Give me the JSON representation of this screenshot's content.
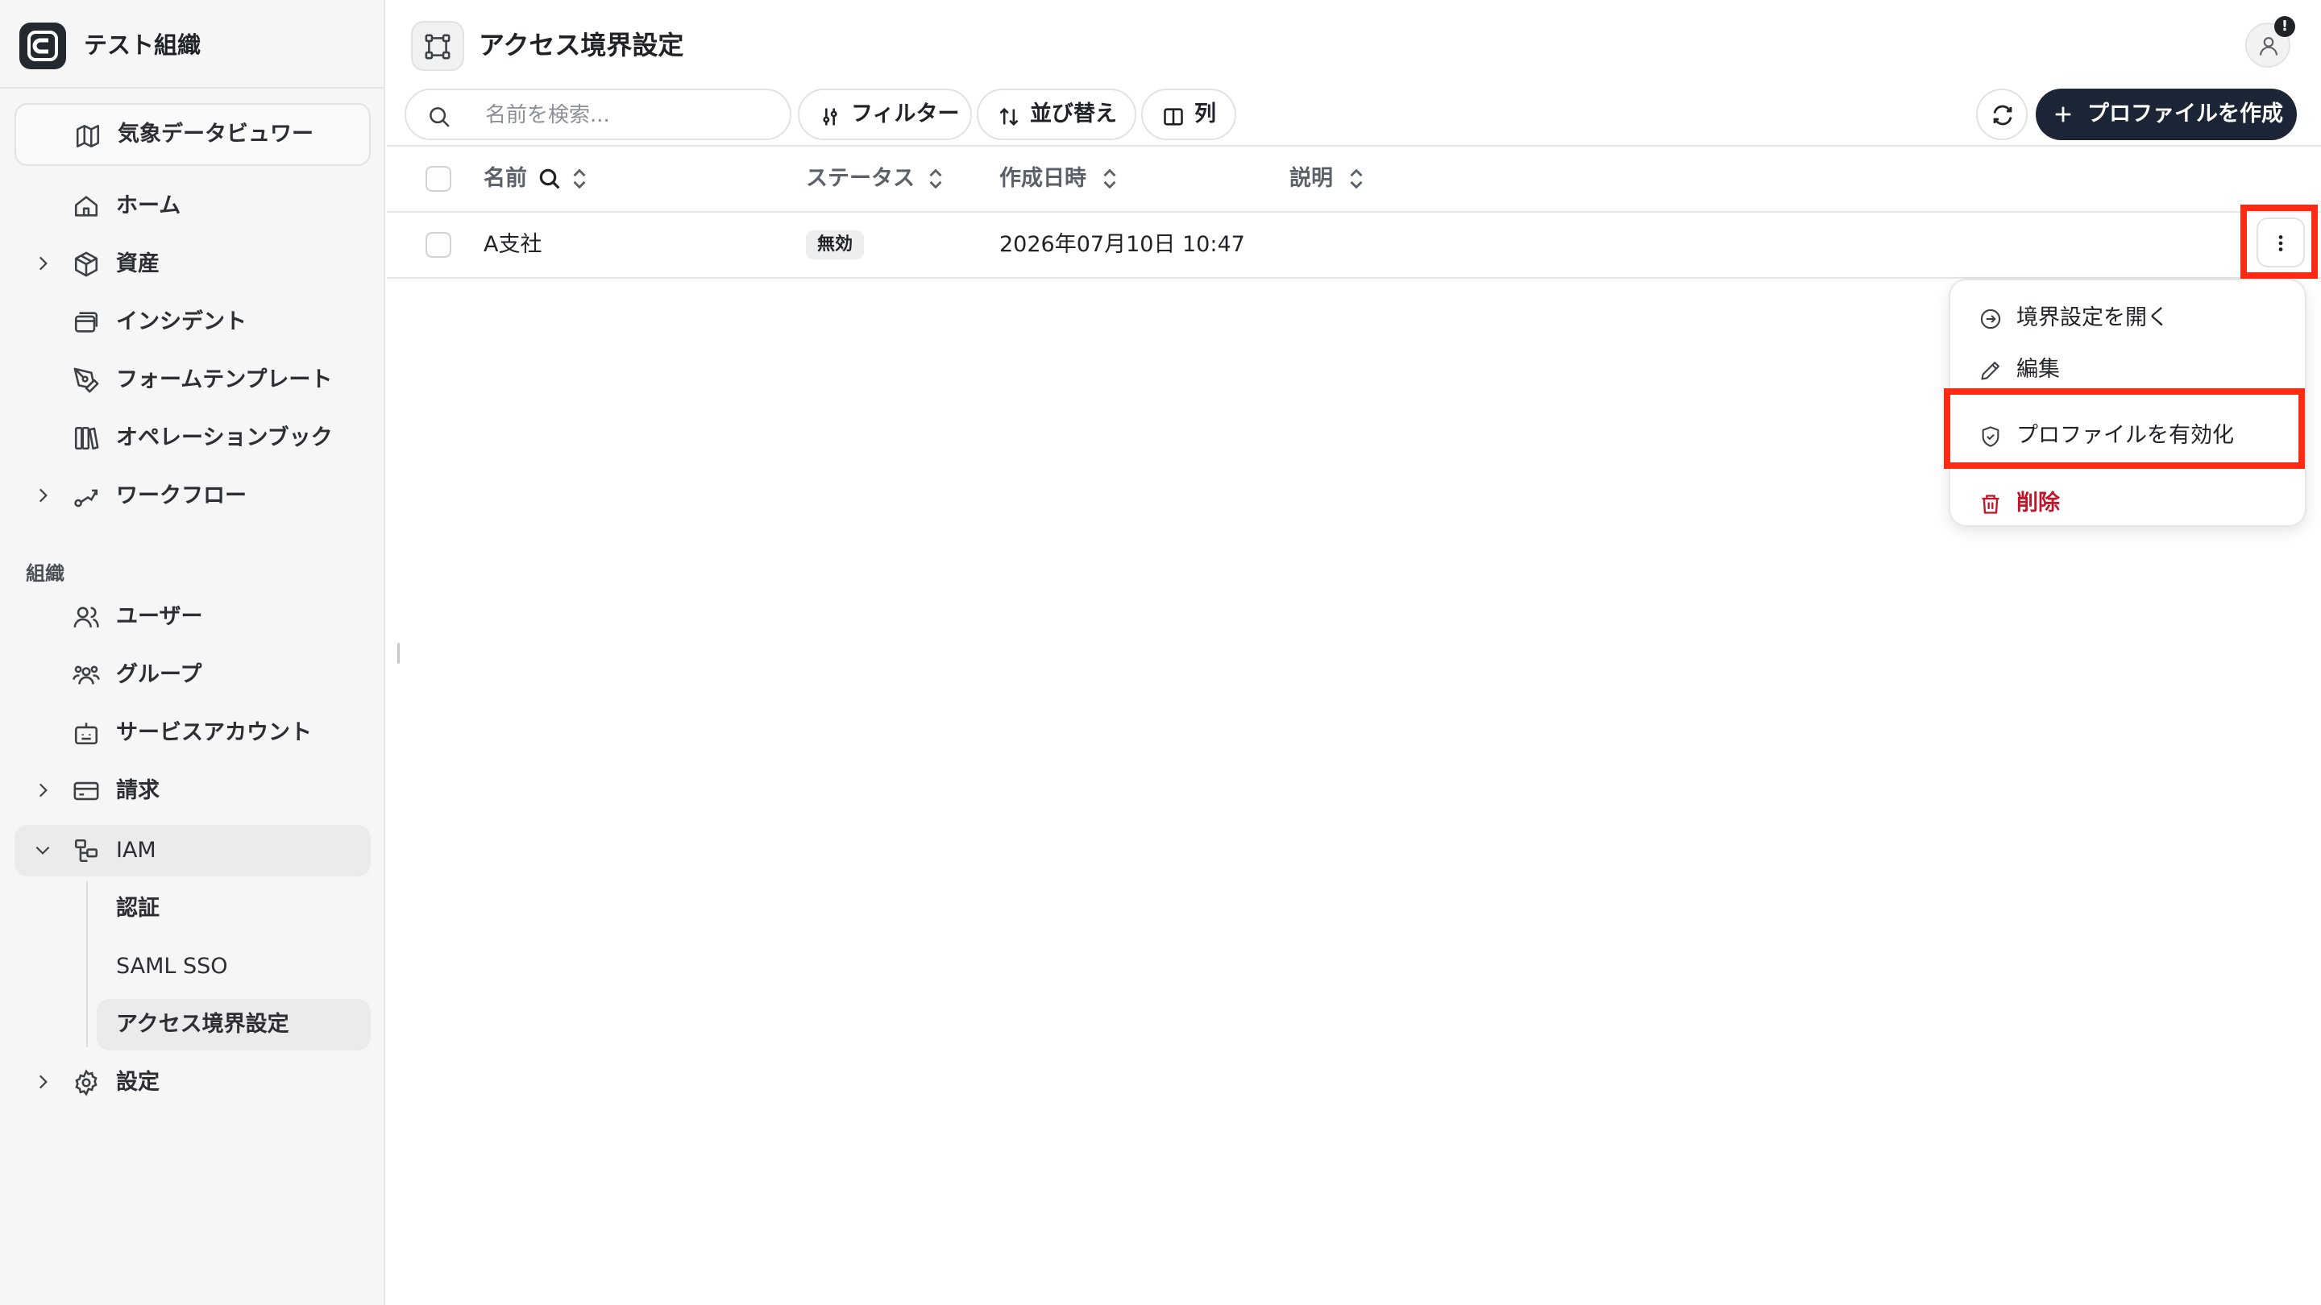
{
  "org": {
    "name": "テスト組織"
  },
  "sidebar": {
    "weather_viewer": "気象データビュワー",
    "items": [
      {
        "label": "ホーム"
      },
      {
        "label": "資産"
      },
      {
        "label": "インシデント"
      },
      {
        "label": "フォームテンプレート"
      },
      {
        "label": "オペレーションブック"
      },
      {
        "label": "ワークフロー"
      }
    ],
    "section_label": "組織",
    "org_items": [
      {
        "label": "ユーザー"
      },
      {
        "label": "グループ"
      },
      {
        "label": "サービスアカウント"
      },
      {
        "label": "請求"
      },
      {
        "label": "IAM"
      }
    ],
    "iam_sub": [
      {
        "label": "認証"
      },
      {
        "label": "SAML SSO"
      },
      {
        "label": "アクセス境界設定"
      }
    ],
    "settings": "設定"
  },
  "header": {
    "title": "アクセス境界設定",
    "notification_badge": "!"
  },
  "toolbar": {
    "search_placeholder": "名前を検索...",
    "filter": "フィルター",
    "sort": "並び替え",
    "columns": "列",
    "create": "プロファイルを作成"
  },
  "table": {
    "headers": {
      "name": "名前",
      "status": "ステータス",
      "created": "作成日時",
      "description": "説明"
    },
    "rows": [
      {
        "name": "A支社",
        "status": "無効",
        "created": "2026年07月10日 10:47",
        "description": ""
      }
    ]
  },
  "menu": {
    "open": "境界設定を開く",
    "edit": "編集",
    "enable": "プロファイルを有効化",
    "delete": "削除"
  },
  "colors": {
    "primary_button": "#1b2535",
    "danger": "#c0152a",
    "highlight": "#ff2a14"
  }
}
